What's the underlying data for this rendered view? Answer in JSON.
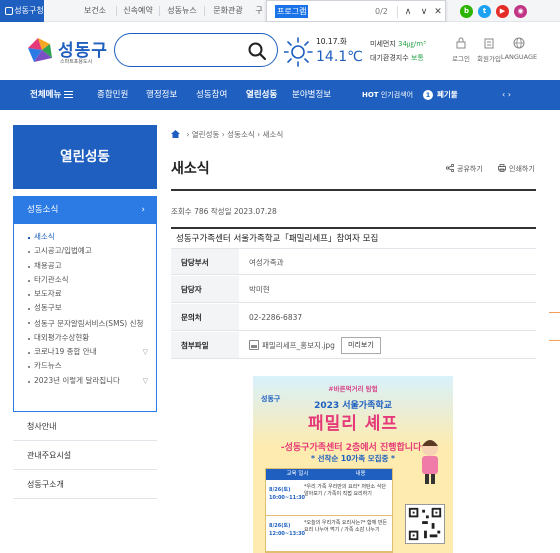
{
  "topbar": {
    "tabs": [
      "성동구청",
      "보건소",
      "신속예약",
      "성동뉴스",
      "문화관광",
      "구의"
    ]
  },
  "findbar": {
    "query": "프로그램",
    "count": "0/2",
    "up": "∧",
    "down": "∨",
    "close": "✕"
  },
  "social": [
    "b",
    "t",
    "▶",
    "◉"
  ],
  "header": {
    "logo_name": "성동구",
    "logo_slogan": "스마트포용도시",
    "date": "10.17.화",
    "temp": "14.1℃",
    "dust_label": "미세먼지",
    "dust_value": "34㎍/m³",
    "air_label": "대기환경지수",
    "air_value": "보통",
    "util": [
      "로그인",
      "회원가입",
      "LANGUAGE"
    ]
  },
  "nav": {
    "all": "전체메뉴",
    "items": [
      "종합민원",
      "행정정보",
      "성동참여",
      "열린성동",
      "분야별정보"
    ],
    "hot_label": "HOT",
    "hot_text": "인기검색어",
    "rank": "1",
    "keyword": "폐기물",
    "arrows": "‹ ›"
  },
  "sidebar": {
    "title": "열린성동",
    "section": "성동소식",
    "items": [
      "새소식",
      "고시공고/입법예고",
      "채용공고",
      "타기관소식",
      "보도자료",
      "성동구보",
      "성동구 문자알림서비스(SMS) 신청",
      "대외평가수상현황",
      "코로나19 종합 안내",
      "카드뉴스",
      "2023년 이렇게 달라집니다"
    ],
    "others": [
      "청사안내",
      "관내주요시설",
      "성동구소개"
    ]
  },
  "content": {
    "breadcrumb": [
      "열린성동",
      "성동소식",
      "새소식"
    ],
    "title": "새소식",
    "share": "공유하기",
    "print": "인쇄하기",
    "meta": "조회수 786 작성일 2023.07.28",
    "post_title": "성동구가족센터 서울가족학교「패밀리세프」참여자 모집",
    "rows": [
      {
        "label": "담당부서",
        "value": "여성가족과"
      },
      {
        "label": "담당자",
        "value": "박미현"
      },
      {
        "label": "문의처",
        "value": "02-2286-6837"
      },
      {
        "label": "첨부파일",
        "value": "패밀리세프_홍보지.jpg"
      }
    ],
    "preview_button": "미리보기"
  },
  "poster": {
    "kw1": "#바른먹거리 탐험",
    "brand": "성동구",
    "kw2": "2023 서울가족학교",
    "kw3": "패밀리 셰프",
    "kw4": "-성동구가족센터 2층에서 진행합니다-",
    "kw5": "* 선착순 10가족 모집중 *",
    "table_head": [
      "교육 일시",
      "내용"
    ],
    "rows": [
      {
        "date": "8/26(토) 10:00~11:30",
        "content": "*우리 가족 우리만의 요리* 저탄소 식단 알아보기 / 가족이 직접 요리하기"
      },
      {
        "date": "8/26(토) 12:00~13:30",
        "content": "*오늘의 우리가족 요리사는?* 함께 만든 요리 나누어 먹기 / 가족 소감 나누기"
      }
    ]
  },
  "colors": {
    "brand": "#1e5fbf",
    "sub": "#2c7be5",
    "pink": "#e5397a"
  }
}
